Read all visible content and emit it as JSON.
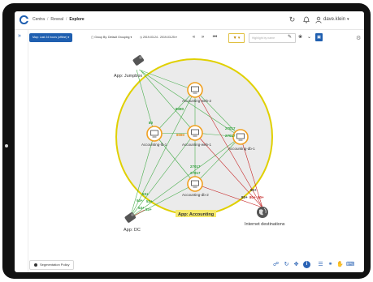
{
  "topbar": {
    "breadcrumbs": [
      "Centra",
      "Reveal",
      "Explore"
    ],
    "user_name": "dave.klein",
    "icons": [
      "refresh-icon",
      "bell-icon",
      "user-icon"
    ]
  },
  "toolbar": {
    "map_button": "Map: Last 24 hours (offline)",
    "group_by": "Group By: Default Grouping",
    "date_range": "2019-03-24 - 2019-03-25",
    "search_placeholder": "Highlight by name"
  },
  "map": {
    "assets": [
      {
        "label": "Accounting-web-2"
      },
      {
        "label": "Accounting-lb-1"
      },
      {
        "label": "Accounting-web-1"
      },
      {
        "label": "Accounting-db-1"
      },
      {
        "label": "Accounting-db-2"
      }
    ],
    "group_label": "App: Accounting",
    "jumpbox_label": "App: Jumpbox",
    "dc_label": "App: DC",
    "internet_label": "Internet destinations",
    "ports": {
      "p8080_top": "8080",
      "p80": "80",
      "p8080_mid": "8080",
      "p27017_r1": "27017",
      "p27017_r2": "27017",
      "p27017_b1": "27017",
      "p27017_b2": "27017",
      "p53_a": "53+",
      "p53_b": "53+",
      "p53_c": "53+",
      "p53_d": "53+",
      "p53_e": "53+",
      "p80_i1": "80+",
      "p80_i2": "80+",
      "p80_i3": "80+",
      "p80_i4": "80+"
    }
  },
  "bottombar": {
    "segmentation_policy": "Segmentation Policy",
    "icons": [
      "share-icon",
      "rotate-icon",
      "move-icon",
      "info-icon",
      "list-icon",
      "link-icon",
      "hand-icon",
      "keyboard-icon"
    ]
  },
  "colors": {
    "accent": "#1f5fb0",
    "group_fill": "#ebebeb",
    "group_border": "#e0d000",
    "asset_ring": "#f0a020",
    "flow_green": "#4caf50",
    "flow_red": "#c62828",
    "port_green": "#2e9e3a",
    "port_orange": "#e08a10"
  }
}
